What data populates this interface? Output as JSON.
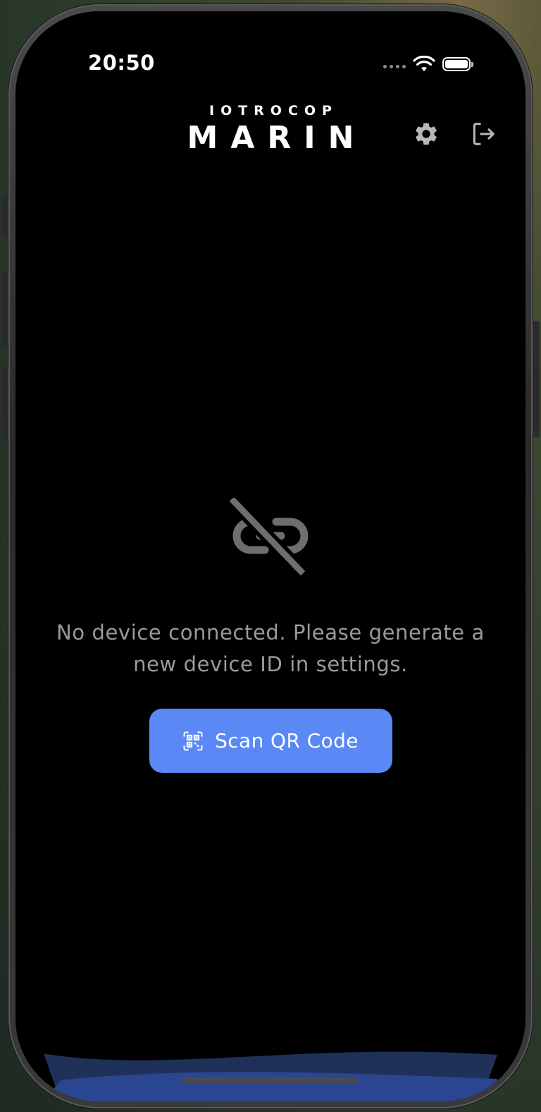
{
  "status_bar": {
    "time": "20:50"
  },
  "header": {
    "brand_top": "IOTROCOP",
    "brand_main": "MARIN",
    "settings_icon": "gear-icon",
    "logout_icon": "logout-icon"
  },
  "empty_state": {
    "icon": "broken-link-icon",
    "message": "No device connected. Please generate a new device ID in settings.",
    "scan_button_label": "Scan QR Code",
    "scan_button_icon": "qr-code-icon"
  },
  "colors": {
    "background": "#000000",
    "accent": "#5a88f5",
    "muted_text": "#9a9a9a",
    "icon_muted": "#6e6e6e",
    "header_icon": "#b8b8b8"
  }
}
